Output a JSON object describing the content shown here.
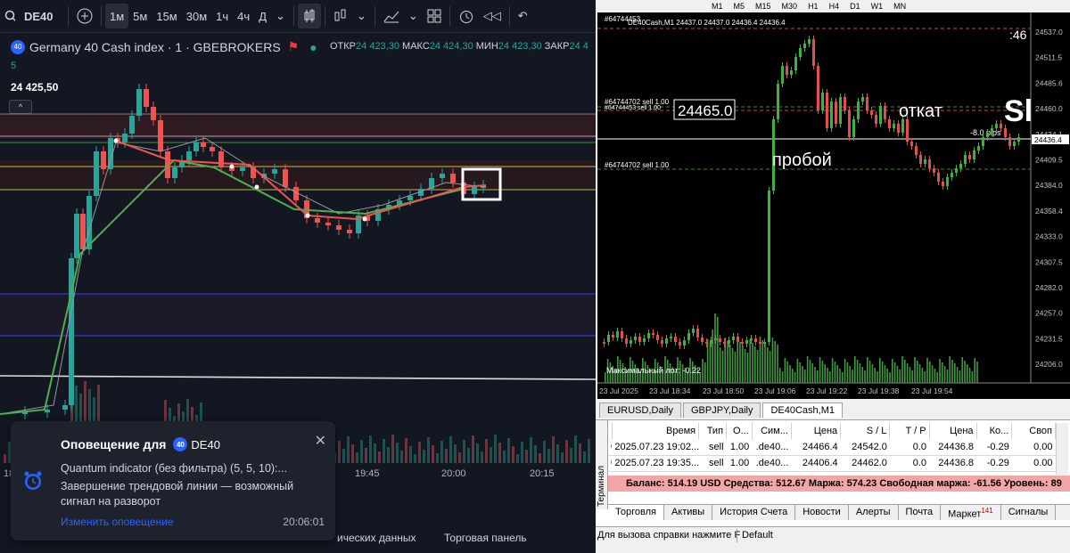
{
  "tv": {
    "toolbar": {
      "symbol": "DE40",
      "timeframes": [
        "1м",
        "5м",
        "15м",
        "30м",
        "1ч",
        "4ч",
        "Д"
      ],
      "active_timeframe": "1м"
    },
    "legend": {
      "badge": "40",
      "title": "Germany 40 Cash index · 1 · GBEBROKERS",
      "sub": "5",
      "open_label": "ОТКР",
      "open": "24 423,30",
      "high_label": "МАКС",
      "high": "24 424,30",
      "low_label": "МИН",
      "low": "24 423,30",
      "close_label": "ЗАКР",
      "close": "24 4"
    },
    "price_label": "24 425,50",
    "collapse": "^",
    "time_labels": [
      "18",
      "19:45",
      "20:00",
      "20:15"
    ],
    "bottom_tabs": [
      "ических данных",
      "Торговая панель"
    ],
    "notification": {
      "title": "Оповещение для",
      "badge": "40",
      "symbol": "DE40",
      "line1": "Quantum indicator (без фильтра) (5, 5, 10):...",
      "line2": "Завершение трендовой линии — возможный",
      "line3": "сигнал на разворот",
      "edit": "Изменить оповещение",
      "time": "20:06:01",
      "close": "✕"
    }
  },
  "mt": {
    "timeframes": [
      "M1",
      "M5",
      "M15",
      "M30",
      "H1",
      "H4",
      "D1",
      "W1",
      "MN"
    ],
    "chart_title": "DE40Cash,M1  24437.0 24437.0 24436.4 24436.4",
    "order_ids": [
      "#64744453",
      "#64744702 sell 1.00",
      "#64744453 sell 1.00",
      "#64744702 sell 1.00"
    ],
    "annotations": {
      "price_box": "24465.0",
      "breakout": "пробой",
      "pullback": "откат",
      "sl": "Sl",
      "timer": ":46",
      "pips": "-8.0 pips",
      "max_lot": "Максимальный лот: -0.22"
    },
    "price_axis": [
      "24537.0",
      "24511.5",
      "24485.6",
      "24460.0",
      "24434.1",
      "24409.5",
      "24384.0",
      "24358.4",
      "24333.0",
      "24307.5",
      "24282.0",
      "24257.0",
      "24231.5",
      "24206.0"
    ],
    "current_price": "24436.4",
    "time_axis": [
      "23 Jul 2025",
      "23 Jul 18:34",
      "23 Jul 18:50",
      "23 Jul 19:06",
      "23 Jul 19:22",
      "23 Jul 19:38",
      "23 Jul 19:54"
    ],
    "chart_tabs": [
      "EURUSD,Daily",
      "GBPJPY,Daily",
      "DE40Cash,M1"
    ],
    "terminal_label": "Терминал",
    "columns": [
      "",
      "Время",
      "Тип",
      "О...",
      "Сим...",
      "Цена",
      "S / L",
      "T / P",
      "Цена",
      "Ко...",
      "Своп"
    ],
    "orders": [
      [
        "",
        "2025.07.23 19:02...",
        "sell",
        "1.00",
        ".de40...",
        "24466.4",
        "24542.0",
        "0.0",
        "24436.8",
        "-0.29",
        "0.00"
      ],
      [
        "",
        "2025.07.23 19:35...",
        "sell",
        "1.00",
        ".de40...",
        "24406.4",
        "24462.0",
        "0.0",
        "24436.8",
        "-0.29",
        "0.00"
      ]
    ],
    "balance": "Баланс: 514.19 USD  Средства: 512.67  Маржа: 574.23  Свободная маржа: -61.56  Уровень: 89",
    "terminal_tabs": [
      "Торговля",
      "Активы",
      "История Счета",
      "Новости",
      "Алерты",
      "Почта",
      "Маркет",
      "Сигналы"
    ],
    "market_badge": "141",
    "status_help": "Для вызова справки нажмите F",
    "status_profile": "Default"
  }
}
